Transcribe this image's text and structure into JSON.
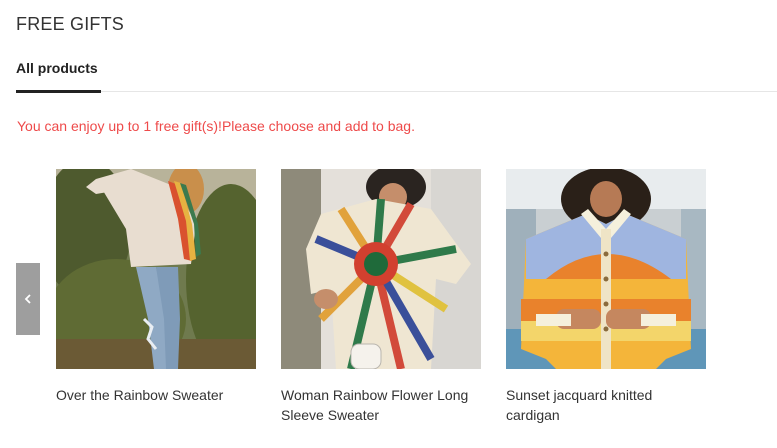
{
  "header": {
    "title": "FREE GIFTS"
  },
  "tabs": [
    {
      "label": "All products"
    }
  ],
  "notice": "You can enjoy up to 1 free gift(s)!Please choose and add to bag.",
  "colors": {
    "notice": "#ee4a4a",
    "arrow_bg": "#9e9e9e",
    "tab_underline": "#222222"
  },
  "carousel": {
    "prev_icon": "chevron-left-icon"
  },
  "products": [
    {
      "name": "Over the Rainbow Sweater"
    },
    {
      "name": "Woman Rainbow Flower Long Sleeve Sweater"
    },
    {
      "name": "Sunset jacquard knitted cardigan"
    }
  ]
}
